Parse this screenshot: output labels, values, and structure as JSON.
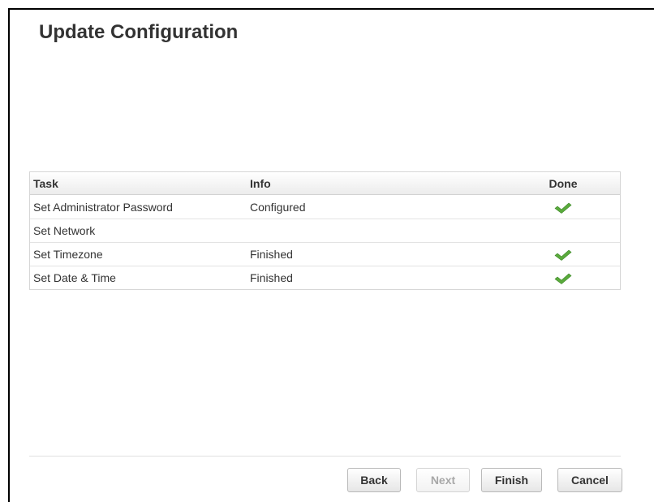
{
  "dialog": {
    "title": "Update Configuration"
  },
  "table": {
    "headers": {
      "task": "Task",
      "info": "Info",
      "done": "Done"
    },
    "rows": [
      {
        "task": "Set Administrator Password",
        "info": "Configured",
        "done": true
      },
      {
        "task": "Set Network",
        "info": "",
        "done": false
      },
      {
        "task": "Set Timezone",
        "info": "Finished",
        "done": true
      },
      {
        "task": "Set Date & Time",
        "info": "Finished",
        "done": true
      }
    ]
  },
  "buttons": {
    "back": "Back",
    "next": "Next",
    "finish": "Finish",
    "cancel": "Cancel",
    "next_disabled": true
  },
  "colors": {
    "check": "#5aaa3c",
    "title": "#333333"
  },
  "icons": {
    "done": "check-icon"
  }
}
